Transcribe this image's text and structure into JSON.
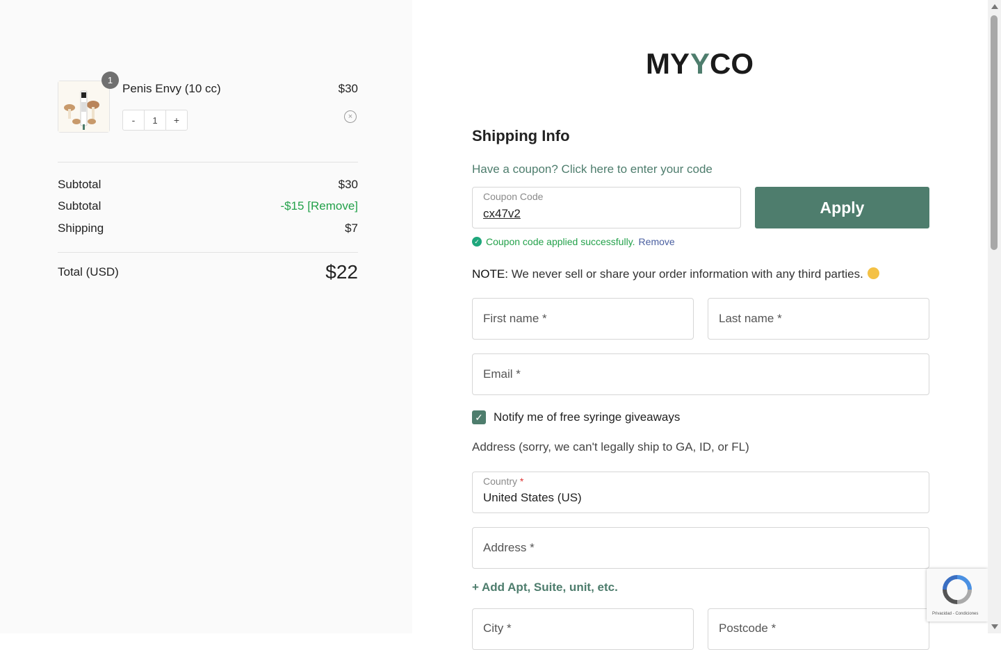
{
  "cart": {
    "badge_count": "1",
    "product_name": "Penis Envy (10 cc)",
    "product_price": "$30",
    "qty_minus": "-",
    "qty_value": "1",
    "qty_plus": "+",
    "remove_glyph": "×"
  },
  "summary": {
    "subtotal_label": "Subtotal",
    "subtotal_value": "$30",
    "discount_label": "Subtotal",
    "discount_value": "-$15",
    "discount_remove": "[Remove]",
    "shipping_label": "Shipping",
    "shipping_value": "$7",
    "total_label": "Total (USD)",
    "total_value": "$22"
  },
  "brand": {
    "logo_text_left": "MY",
    "logo_text_mid": "Y",
    "logo_text_right": "CO",
    "accent_color": "#4e7d6d"
  },
  "form": {
    "heading": "Shipping Info",
    "coupon_link": "Have a coupon? Click here to enter your code",
    "coupon_label": "Coupon Code",
    "coupon_value": "cx47v2",
    "apply_label": "Apply",
    "coupon_success": "Coupon code applied successfully.",
    "coupon_remove": "Remove",
    "note_bold": "NOTE:",
    "note_text": "We never sell or share your order information with any third parties.",
    "first_name_placeholder": "First name *",
    "last_name_placeholder": "Last name *",
    "email_placeholder": "Email *",
    "notify_label": "Notify me of free syringe giveaways",
    "address_note": "Address (sorry, we can't legally ship to GA, ID, or FL)",
    "country_label": "Country",
    "country_required": "*",
    "country_value": "United States (US)",
    "address_placeholder": "Address *",
    "add_apt_label": "+ Add Apt, Suite, unit, etc.",
    "city_placeholder": "City *",
    "postcode_placeholder": "Postcode *"
  },
  "recaptcha": {
    "footer_text": "Privacidad - Condiciones"
  }
}
